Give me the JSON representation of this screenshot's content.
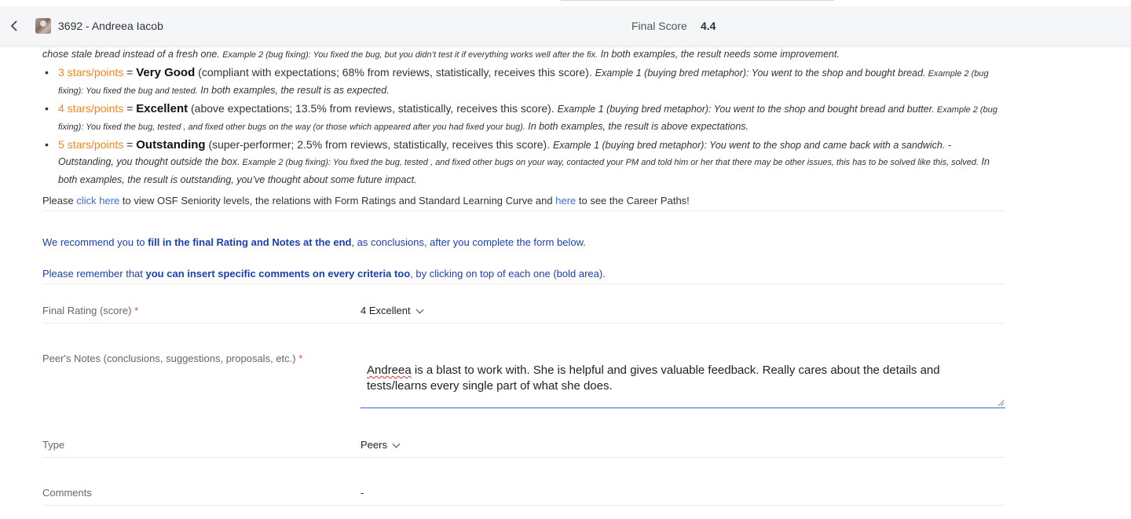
{
  "header": {
    "title": "3692 - Andreea Iacob",
    "final_score_label": "Final Score",
    "final_score_value": "4.4"
  },
  "description": {
    "line0": {
      "main": "chose stale bread instead of a fresh one.",
      "ex2": "Example 2 (bug fixing): You fixed the bug, but you didn’t test it if everything works well after the fix.",
      "tail": " In both examples, the result needs some improvement."
    },
    "items": [
      {
        "stars": "3 stars/points",
        "eq": " = ",
        "grade": "Very Good",
        "detail": " (compliant with expectations; 68% from reviews, statistically, receives this score). ",
        "ex1": "Example 1 (buying bred metaphor): You went to the shop and bought bread.",
        "ex2": " Example 2 (bug fixing): You fixed the bug and tested.",
        "tail": " In both examples, the result is as expected."
      },
      {
        "stars": "4 stars/points",
        "eq": " = ",
        "grade": "Excellent",
        "detail": " (above expectations; 13.5% from reviews, statistically, receives this score). ",
        "ex1": "Example 1 (buying bred metaphor): You went to the shop and bought bread and butter.",
        "ex2": " Example 2 (bug fixing): You fixed the bug, tested , and fixed other bugs on the way (or those which appeared after you had fixed your bug).",
        "tail": " In both examples, the result is above expectations."
      },
      {
        "stars": "5 stars/points",
        "eq": " = ",
        "grade": "Outstanding",
        "detail": " (super-performer; 2.5% from reviews, statistically, receives this score). ",
        "ex1": "Example 1 (buying bred metaphor): You went to the shop and came back with a sandwich. - Outstanding, you thought outside the box.",
        "ex2": " Example 2 (bug fixing): You fixed the bug, tested , and fixed other bugs on your way, contacted your PM and told him or her that there may be other issues, this has to be solved like this, solved.",
        "tail": " In both examples, the result is outstanding, you’ve thought about some future impact."
      }
    ],
    "links_para": {
      "pre": "Please ",
      "link1": "click here",
      "mid": " to view OSF Seniority levels, the relations with Form Ratings and Standard Learning Curve and ",
      "link2": "here",
      "post": " to see the  Career Paths!"
    }
  },
  "recommend": {
    "pre": "We recommend you to ",
    "bold": "fill in the final Rating and Notes at the end",
    "post": ", as conclusions, after you complete the form below."
  },
  "remember": {
    "pre": "Please remember that ",
    "bold": "you can insert specific comments on every criteria too",
    "post": ", by clicking on top of each one (bold area)."
  },
  "form": {
    "final_rating": {
      "label": "Final Rating (score)",
      "required": "*",
      "value": "4 Excellent"
    },
    "notes": {
      "label": "Peer's Notes (conclusions, suggestions, proposals, etc.)",
      "required": "*",
      "name": "Andreea",
      "text": " is a blast to work with. She is helpful and gives valuable feedback. Really cares about the details and tests/learns every single part of what she does."
    },
    "type": {
      "label": "Type",
      "value": "Peers"
    },
    "comments": {
      "label": "Comments",
      "value": "-"
    }
  },
  "colors": {
    "stars": "#f0861e",
    "link": "#3b6fd6",
    "recommend": "#1b3fb0",
    "required": "#e04c4c",
    "focus": "#2c6fd1"
  }
}
